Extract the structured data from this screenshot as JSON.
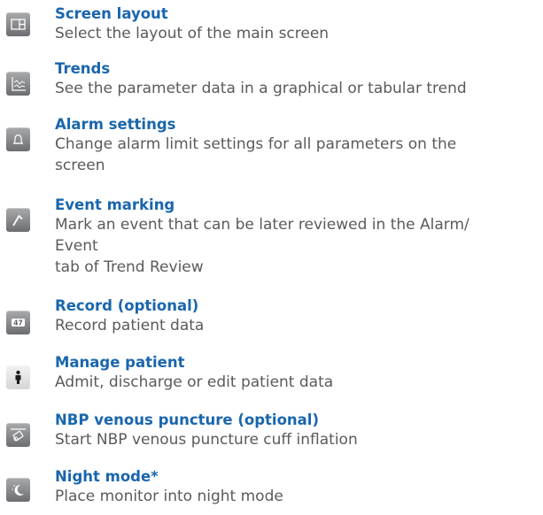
{
  "items": [
    {
      "icon": "screen-layout-icon",
      "title": "Screen layout",
      "lines": [
        "Select the layout of the main screen"
      ]
    },
    {
      "icon": "trends-icon",
      "title": "Trends",
      "lines": [
        "See the parameter data in a graphical or tabular trend"
      ]
    },
    {
      "icon": "alarm-bell-icon",
      "title": "Alarm settings",
      "lines": [
        "Change alarm limit settings for all parameters on the",
        "screen"
      ]
    },
    {
      "icon": "event-flag-icon",
      "title": "Event marking",
      "lines": [
        "Mark an event that can be later reviewed in the Alarm/",
        "Event",
        "tab of Trend Review"
      ]
    },
    {
      "icon": "recorder-icon",
      "title": "Record (optional)",
      "lines": [
        "Record patient data"
      ]
    },
    {
      "icon": "patient-figure-icon",
      "title": "Manage patient",
      "lines": [
        "Admit, discharge or edit patient data"
      ]
    },
    {
      "icon": "nbp-cuff-icon",
      "title": "NBP venous puncture (optional)",
      "lines": [
        "Start NBP venous puncture cuff inflation"
      ]
    },
    {
      "icon": "moon-icon",
      "title": "Night mode*",
      "lines": [
        "Place monitor into night mode"
      ]
    }
  ]
}
